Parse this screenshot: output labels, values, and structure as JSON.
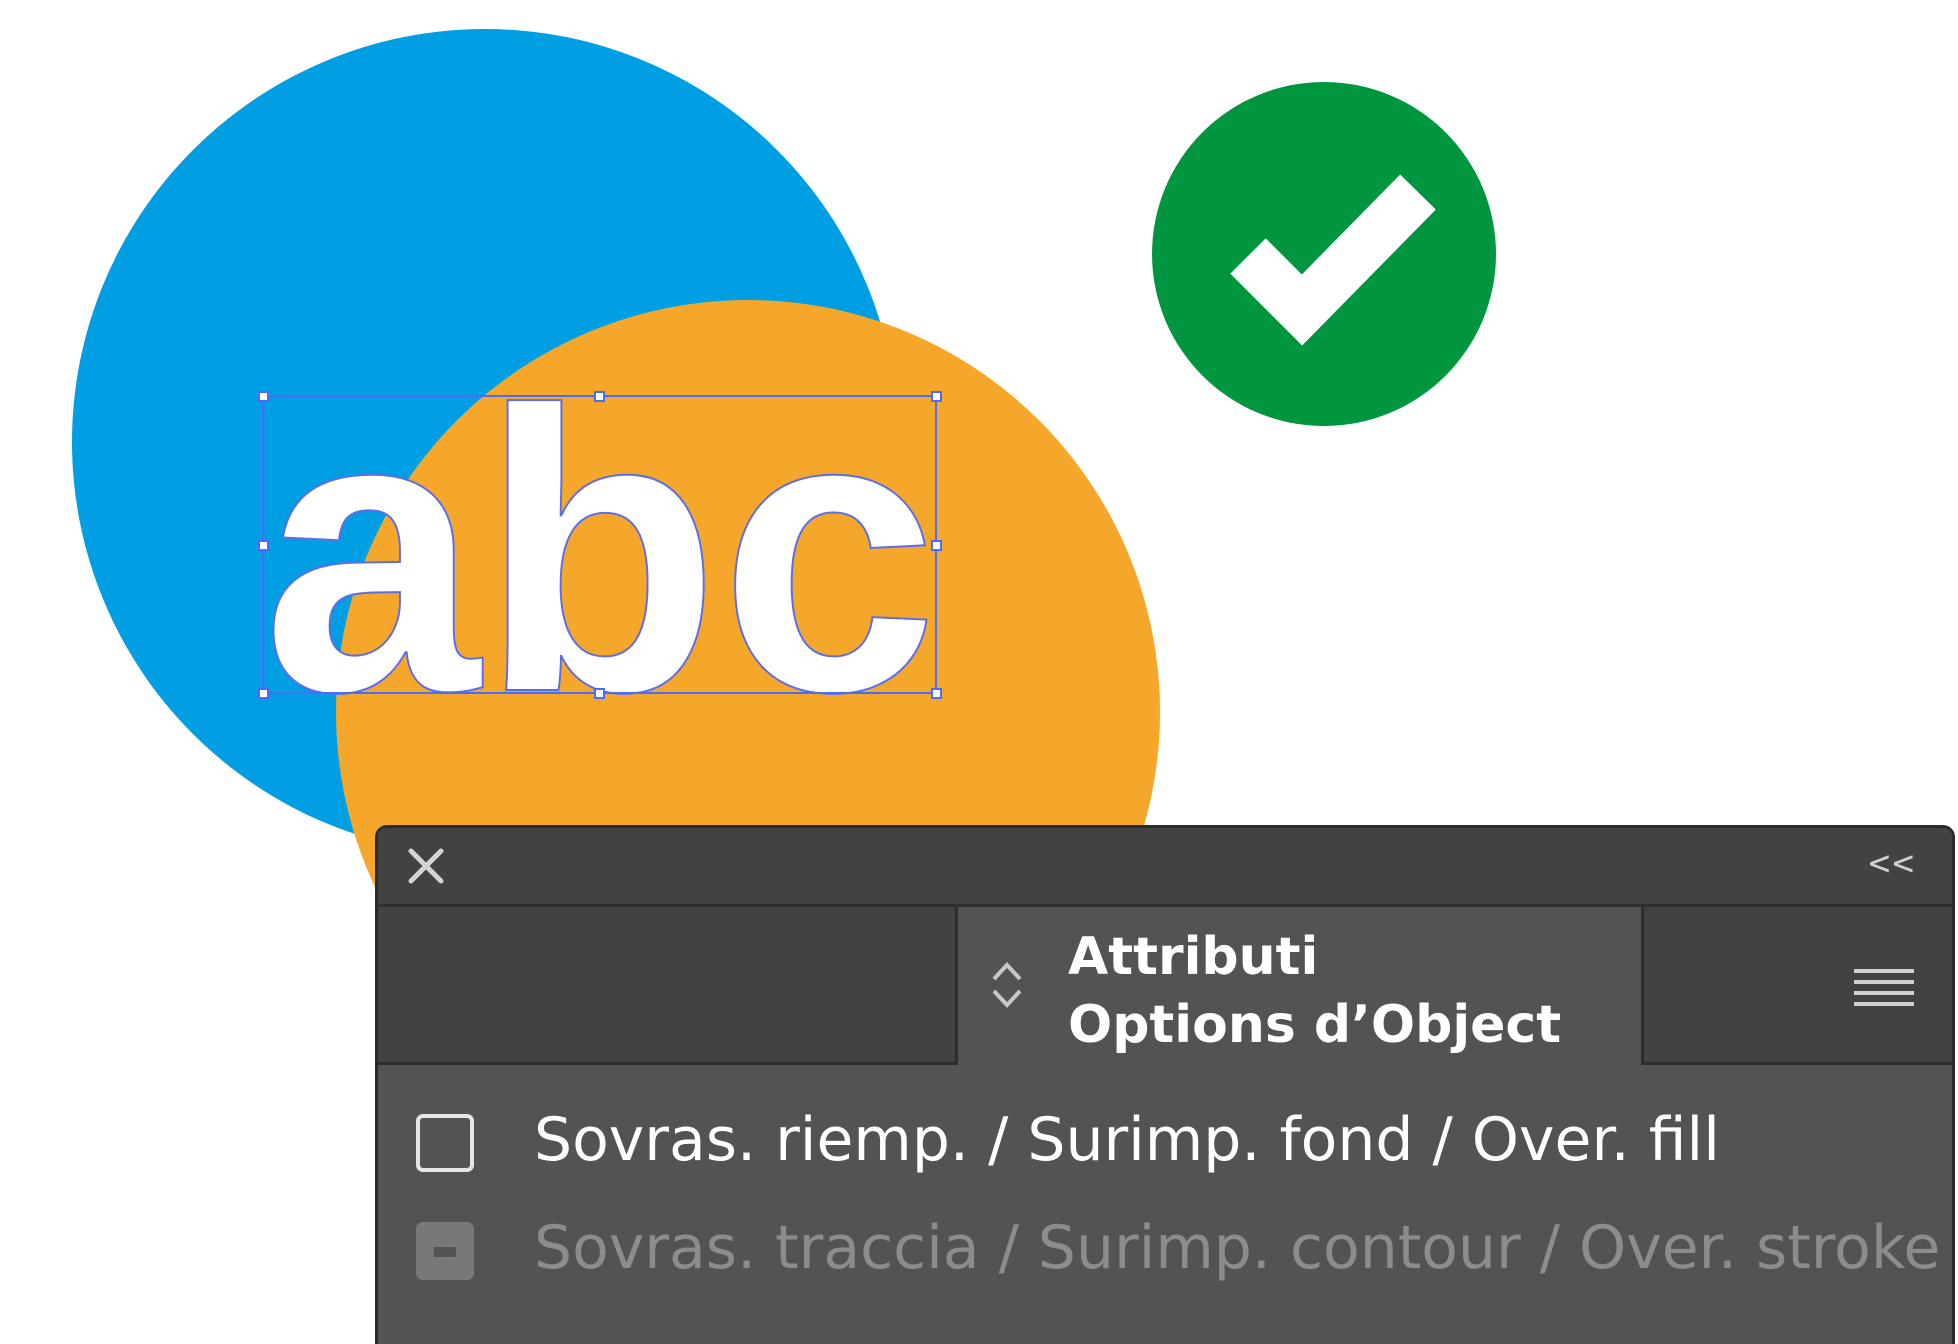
{
  "artboard": {
    "selected_text": "abc",
    "colors": {
      "blue_circle": "#009FE3",
      "orange_circle": "#F5A72C",
      "check_badge": "#009640",
      "selection": "#4a6cf7"
    }
  },
  "panel": {
    "close_icon": "close-icon",
    "collapse_label": "<<",
    "tab_title_line1": "Attributi",
    "tab_title_line2": "Options d’Object",
    "menu_icon": "hamburger-menu-icon",
    "options": [
      {
        "label": "Sovras. riemp. / Surimp. fond / Over. fill",
        "checked": false,
        "enabled": true
      },
      {
        "label": "Sovras. traccia / Surimp. contour / Over. stroke",
        "checked": false,
        "enabled": false
      }
    ]
  }
}
